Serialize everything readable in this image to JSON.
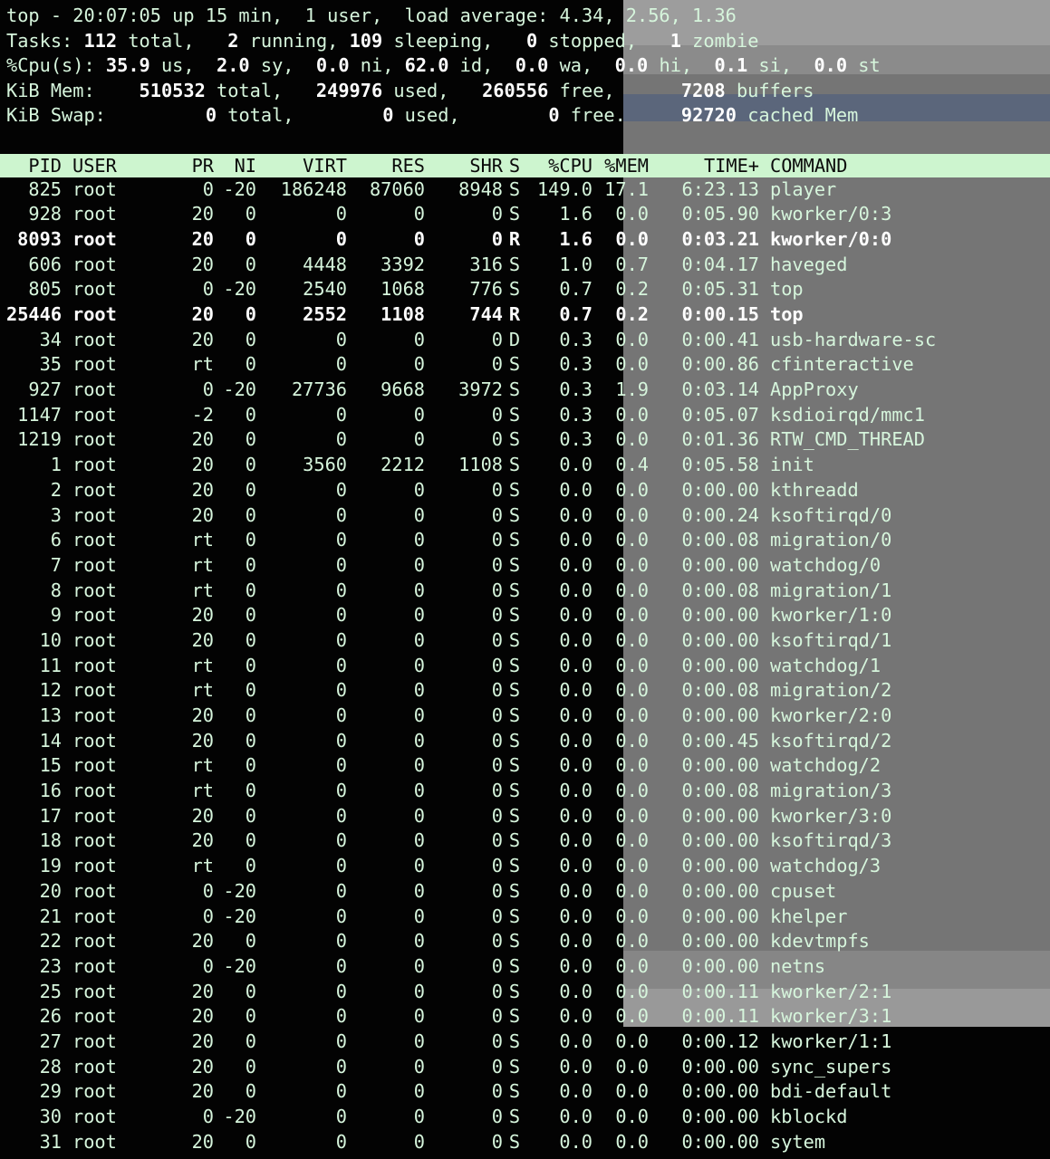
{
  "colors": {
    "terminal_bg": "#030303",
    "text": "#d6f5dc",
    "header_bar_bg": "#cdf5cf",
    "header_bar_text": "#0b0b0b",
    "bold_text": "#ffffff"
  },
  "summary": {
    "uptime_line": {
      "prefix": "top - 20:07:05 up 15 min,  1 user,  load average: 4.34, 2.56, 1.36"
    },
    "tasks": {
      "label": "Tasks:",
      "total": "112",
      "total_label": " total,",
      "running": "2",
      "running_label": " running,",
      "sleeping": "109",
      "sleeping_label": " sleeping,",
      "stopped": "0",
      "stopped_label": " stopped,",
      "zombie": "1",
      "zombie_label": " zombie"
    },
    "cpu": {
      "label": "%Cpu(s):",
      "us": "35.9",
      "us_label": " us,",
      "sy": "2.0",
      "sy_label": " sy,",
      "ni": "0.0",
      "ni_label": " ni,",
      "id": "62.0",
      "id_label": " id,",
      "wa": "0.0",
      "wa_label": " wa,",
      "hi": "0.0",
      "hi_label": " hi,",
      "si": "0.1",
      "si_label": " si,",
      "st": "0.0",
      "st_label": " st"
    },
    "mem": {
      "label": "KiB Mem:",
      "total": "510532",
      "total_label": " total,",
      "used": "249976",
      "used_label": " used,",
      "free": "260556",
      "free_label": " free,",
      "buffers": "7208",
      "buffers_label": " buffers"
    },
    "swap": {
      "label": "KiB Swap:",
      "total": "0",
      "total_label": " total,",
      "used": "0",
      "used_label": " used,",
      "free": "0",
      "free_label": " free.",
      "cached": "92720",
      "cached_label": " cached Mem"
    }
  },
  "columns": [
    "PID",
    "USER",
    "PR",
    "NI",
    "VIRT",
    "RES",
    "SHR",
    "S",
    "%CPU",
    "%MEM",
    "TIME+",
    "COMMAND"
  ],
  "processes": [
    {
      "pid": "825",
      "user": "root",
      "pr": "0",
      "ni": "-20",
      "virt": "186248",
      "res": "87060",
      "shr": "8948",
      "s": "S",
      "cpu": "149.0",
      "mem": "17.1",
      "time": "6:23.13",
      "cmd": "player",
      "bold": false
    },
    {
      "pid": "928",
      "user": "root",
      "pr": "20",
      "ni": "0",
      "virt": "0",
      "res": "0",
      "shr": "0",
      "s": "S",
      "cpu": "1.6",
      "mem": "0.0",
      "time": "0:05.90",
      "cmd": "kworker/0:3",
      "bold": false
    },
    {
      "pid": "8093",
      "user": "root",
      "pr": "20",
      "ni": "0",
      "virt": "0",
      "res": "0",
      "shr": "0",
      "s": "R",
      "cpu": "1.6",
      "mem": "0.0",
      "time": "0:03.21",
      "cmd": "kworker/0:0",
      "bold": true
    },
    {
      "pid": "606",
      "user": "root",
      "pr": "20",
      "ni": "0",
      "virt": "4448",
      "res": "3392",
      "shr": "316",
      "s": "S",
      "cpu": "1.0",
      "mem": "0.7",
      "time": "0:04.17",
      "cmd": "haveged",
      "bold": false
    },
    {
      "pid": "805",
      "user": "root",
      "pr": "0",
      "ni": "-20",
      "virt": "2540",
      "res": "1068",
      "shr": "776",
      "s": "S",
      "cpu": "0.7",
      "mem": "0.2",
      "time": "0:05.31",
      "cmd": "top",
      "bold": false
    },
    {
      "pid": "25446",
      "user": "root",
      "pr": "20",
      "ni": "0",
      "virt": "2552",
      "res": "1108",
      "shr": "744",
      "s": "R",
      "cpu": "0.7",
      "mem": "0.2",
      "time": "0:00.15",
      "cmd": "top",
      "bold": true
    },
    {
      "pid": "34",
      "user": "root",
      "pr": "20",
      "ni": "0",
      "virt": "0",
      "res": "0",
      "shr": "0",
      "s": "D",
      "cpu": "0.3",
      "mem": "0.0",
      "time": "0:00.41",
      "cmd": "usb-hardware-sc",
      "bold": false
    },
    {
      "pid": "35",
      "user": "root",
      "pr": "rt",
      "ni": "0",
      "virt": "0",
      "res": "0",
      "shr": "0",
      "s": "S",
      "cpu": "0.3",
      "mem": "0.0",
      "time": "0:00.86",
      "cmd": "cfinteractive",
      "bold": false
    },
    {
      "pid": "927",
      "user": "root",
      "pr": "0",
      "ni": "-20",
      "virt": "27736",
      "res": "9668",
      "shr": "3972",
      "s": "S",
      "cpu": "0.3",
      "mem": "1.9",
      "time": "0:03.14",
      "cmd": "AppProxy",
      "bold": false
    },
    {
      "pid": "1147",
      "user": "root",
      "pr": "-2",
      "ni": "0",
      "virt": "0",
      "res": "0",
      "shr": "0",
      "s": "S",
      "cpu": "0.3",
      "mem": "0.0",
      "time": "0:05.07",
      "cmd": "ksdioirqd/mmc1",
      "bold": false
    },
    {
      "pid": "1219",
      "user": "root",
      "pr": "20",
      "ni": "0",
      "virt": "0",
      "res": "0",
      "shr": "0",
      "s": "S",
      "cpu": "0.3",
      "mem": "0.0",
      "time": "0:01.36",
      "cmd": "RTW_CMD_THREAD",
      "bold": false
    },
    {
      "pid": "1",
      "user": "root",
      "pr": "20",
      "ni": "0",
      "virt": "3560",
      "res": "2212",
      "shr": "1108",
      "s": "S",
      "cpu": "0.0",
      "mem": "0.4",
      "time": "0:05.58",
      "cmd": "init",
      "bold": false
    },
    {
      "pid": "2",
      "user": "root",
      "pr": "20",
      "ni": "0",
      "virt": "0",
      "res": "0",
      "shr": "0",
      "s": "S",
      "cpu": "0.0",
      "mem": "0.0",
      "time": "0:00.00",
      "cmd": "kthreadd",
      "bold": false
    },
    {
      "pid": "3",
      "user": "root",
      "pr": "20",
      "ni": "0",
      "virt": "0",
      "res": "0",
      "shr": "0",
      "s": "S",
      "cpu": "0.0",
      "mem": "0.0",
      "time": "0:00.24",
      "cmd": "ksoftirqd/0",
      "bold": false
    },
    {
      "pid": "6",
      "user": "root",
      "pr": "rt",
      "ni": "0",
      "virt": "0",
      "res": "0",
      "shr": "0",
      "s": "S",
      "cpu": "0.0",
      "mem": "0.0",
      "time": "0:00.08",
      "cmd": "migration/0",
      "bold": false
    },
    {
      "pid": "7",
      "user": "root",
      "pr": "rt",
      "ni": "0",
      "virt": "0",
      "res": "0",
      "shr": "0",
      "s": "S",
      "cpu": "0.0",
      "mem": "0.0",
      "time": "0:00.00",
      "cmd": "watchdog/0",
      "bold": false
    },
    {
      "pid": "8",
      "user": "root",
      "pr": "rt",
      "ni": "0",
      "virt": "0",
      "res": "0",
      "shr": "0",
      "s": "S",
      "cpu": "0.0",
      "mem": "0.0",
      "time": "0:00.08",
      "cmd": "migration/1",
      "bold": false
    },
    {
      "pid": "9",
      "user": "root",
      "pr": "20",
      "ni": "0",
      "virt": "0",
      "res": "0",
      "shr": "0",
      "s": "S",
      "cpu": "0.0",
      "mem": "0.0",
      "time": "0:00.00",
      "cmd": "kworker/1:0",
      "bold": false
    },
    {
      "pid": "10",
      "user": "root",
      "pr": "20",
      "ni": "0",
      "virt": "0",
      "res": "0",
      "shr": "0",
      "s": "S",
      "cpu": "0.0",
      "mem": "0.0",
      "time": "0:00.00",
      "cmd": "ksoftirqd/1",
      "bold": false
    },
    {
      "pid": "11",
      "user": "root",
      "pr": "rt",
      "ni": "0",
      "virt": "0",
      "res": "0",
      "shr": "0",
      "s": "S",
      "cpu": "0.0",
      "mem": "0.0",
      "time": "0:00.00",
      "cmd": "watchdog/1",
      "bold": false
    },
    {
      "pid": "12",
      "user": "root",
      "pr": "rt",
      "ni": "0",
      "virt": "0",
      "res": "0",
      "shr": "0",
      "s": "S",
      "cpu": "0.0",
      "mem": "0.0",
      "time": "0:00.08",
      "cmd": "migration/2",
      "bold": false
    },
    {
      "pid": "13",
      "user": "root",
      "pr": "20",
      "ni": "0",
      "virt": "0",
      "res": "0",
      "shr": "0",
      "s": "S",
      "cpu": "0.0",
      "mem": "0.0",
      "time": "0:00.00",
      "cmd": "kworker/2:0",
      "bold": false
    },
    {
      "pid": "14",
      "user": "root",
      "pr": "20",
      "ni": "0",
      "virt": "0",
      "res": "0",
      "shr": "0",
      "s": "S",
      "cpu": "0.0",
      "mem": "0.0",
      "time": "0:00.45",
      "cmd": "ksoftirqd/2",
      "bold": false
    },
    {
      "pid": "15",
      "user": "root",
      "pr": "rt",
      "ni": "0",
      "virt": "0",
      "res": "0",
      "shr": "0",
      "s": "S",
      "cpu": "0.0",
      "mem": "0.0",
      "time": "0:00.00",
      "cmd": "watchdog/2",
      "bold": false
    },
    {
      "pid": "16",
      "user": "root",
      "pr": "rt",
      "ni": "0",
      "virt": "0",
      "res": "0",
      "shr": "0",
      "s": "S",
      "cpu": "0.0",
      "mem": "0.0",
      "time": "0:00.08",
      "cmd": "migration/3",
      "bold": false
    },
    {
      "pid": "17",
      "user": "root",
      "pr": "20",
      "ni": "0",
      "virt": "0",
      "res": "0",
      "shr": "0",
      "s": "S",
      "cpu": "0.0",
      "mem": "0.0",
      "time": "0:00.00",
      "cmd": "kworker/3:0",
      "bold": false
    },
    {
      "pid": "18",
      "user": "root",
      "pr": "20",
      "ni": "0",
      "virt": "0",
      "res": "0",
      "shr": "0",
      "s": "S",
      "cpu": "0.0",
      "mem": "0.0",
      "time": "0:00.00",
      "cmd": "ksoftirqd/3",
      "bold": false
    },
    {
      "pid": "19",
      "user": "root",
      "pr": "rt",
      "ni": "0",
      "virt": "0",
      "res": "0",
      "shr": "0",
      "s": "S",
      "cpu": "0.0",
      "mem": "0.0",
      "time": "0:00.00",
      "cmd": "watchdog/3",
      "bold": false
    },
    {
      "pid": "20",
      "user": "root",
      "pr": "0",
      "ni": "-20",
      "virt": "0",
      "res": "0",
      "shr": "0",
      "s": "S",
      "cpu": "0.0",
      "mem": "0.0",
      "time": "0:00.00",
      "cmd": "cpuset",
      "bold": false
    },
    {
      "pid": "21",
      "user": "root",
      "pr": "0",
      "ni": "-20",
      "virt": "0",
      "res": "0",
      "shr": "0",
      "s": "S",
      "cpu": "0.0",
      "mem": "0.0",
      "time": "0:00.00",
      "cmd": "khelper",
      "bold": false
    },
    {
      "pid": "22",
      "user": "root",
      "pr": "20",
      "ni": "0",
      "virt": "0",
      "res": "0",
      "shr": "0",
      "s": "S",
      "cpu": "0.0",
      "mem": "0.0",
      "time": "0:00.00",
      "cmd": "kdevtmpfs",
      "bold": false
    },
    {
      "pid": "23",
      "user": "root",
      "pr": "0",
      "ni": "-20",
      "virt": "0",
      "res": "0",
      "shr": "0",
      "s": "S",
      "cpu": "0.0",
      "mem": "0.0",
      "time": "0:00.00",
      "cmd": "netns",
      "bold": false
    },
    {
      "pid": "25",
      "user": "root",
      "pr": "20",
      "ni": "0",
      "virt": "0",
      "res": "0",
      "shr": "0",
      "s": "S",
      "cpu": "0.0",
      "mem": "0.0",
      "time": "0:00.11",
      "cmd": "kworker/2:1",
      "bold": false
    },
    {
      "pid": "26",
      "user": "root",
      "pr": "20",
      "ni": "0",
      "virt": "0",
      "res": "0",
      "shr": "0",
      "s": "S",
      "cpu": "0.0",
      "mem": "0.0",
      "time": "0:00.11",
      "cmd": "kworker/3:1",
      "bold": false
    },
    {
      "pid": "27",
      "user": "root",
      "pr": "20",
      "ni": "0",
      "virt": "0",
      "res": "0",
      "shr": "0",
      "s": "S",
      "cpu": "0.0",
      "mem": "0.0",
      "time": "0:00.12",
      "cmd": "kworker/1:1",
      "bold": false
    },
    {
      "pid": "28",
      "user": "root",
      "pr": "20",
      "ni": "0",
      "virt": "0",
      "res": "0",
      "shr": "0",
      "s": "S",
      "cpu": "0.0",
      "mem": "0.0",
      "time": "0:00.00",
      "cmd": "sync_supers",
      "bold": false
    },
    {
      "pid": "29",
      "user": "root",
      "pr": "20",
      "ni": "0",
      "virt": "0",
      "res": "0",
      "shr": "0",
      "s": "S",
      "cpu": "0.0",
      "mem": "0.0",
      "time": "0:00.00",
      "cmd": "bdi-default",
      "bold": false
    },
    {
      "pid": "30",
      "user": "root",
      "pr": "0",
      "ni": "-20",
      "virt": "0",
      "res": "0",
      "shr": "0",
      "s": "S",
      "cpu": "0.0",
      "mem": "0.0",
      "time": "0:00.00",
      "cmd": "kblockd",
      "bold": false
    },
    {
      "pid": "31",
      "user": "root",
      "pr": "20",
      "ni": "0",
      "virt": "0",
      "res": "0",
      "shr": "0",
      "s": "S",
      "cpu": "0.0",
      "mem": "0.0",
      "time": "0:00.00",
      "cmd": "sytem",
      "bold": false
    }
  ]
}
